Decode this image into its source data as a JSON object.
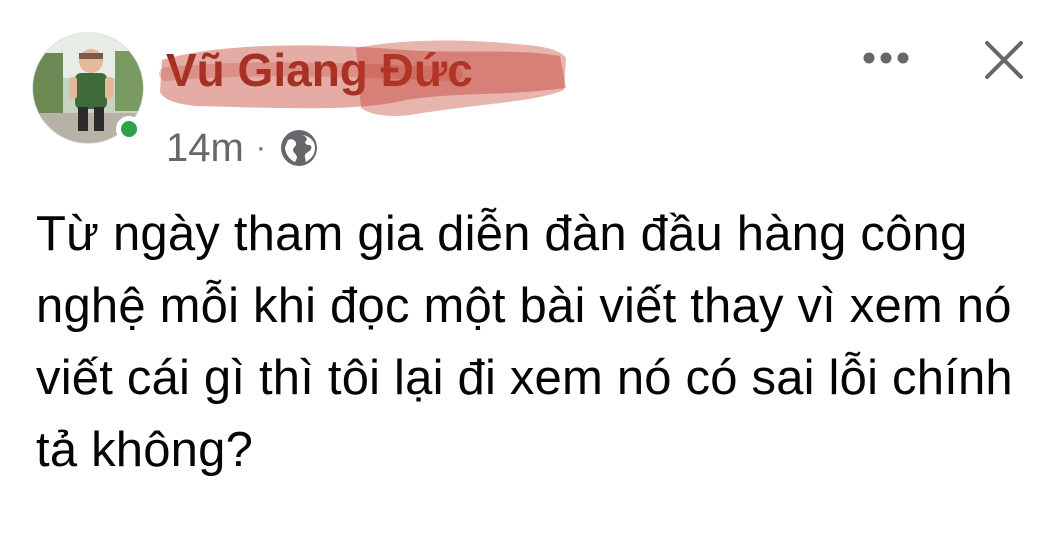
{
  "post": {
    "author_name": "Vũ Giang Đức",
    "time_ago": "14m",
    "separator": "·",
    "privacy_icon": "globe-icon",
    "more_icon": "more-horizontal-icon",
    "close_icon": "close-icon",
    "text": "Từ ngày tham gia diễn đàn đầu hàng công nghệ mỗi khi đọc một bài viết thay vì xem nó viết cái gì thì tôi lại đi xem nó có sai lỗi chính tả không?"
  },
  "colors": {
    "online": "#31a24c",
    "meta": "#65676b",
    "redaction": "#c0392b",
    "text": "#050505"
  }
}
